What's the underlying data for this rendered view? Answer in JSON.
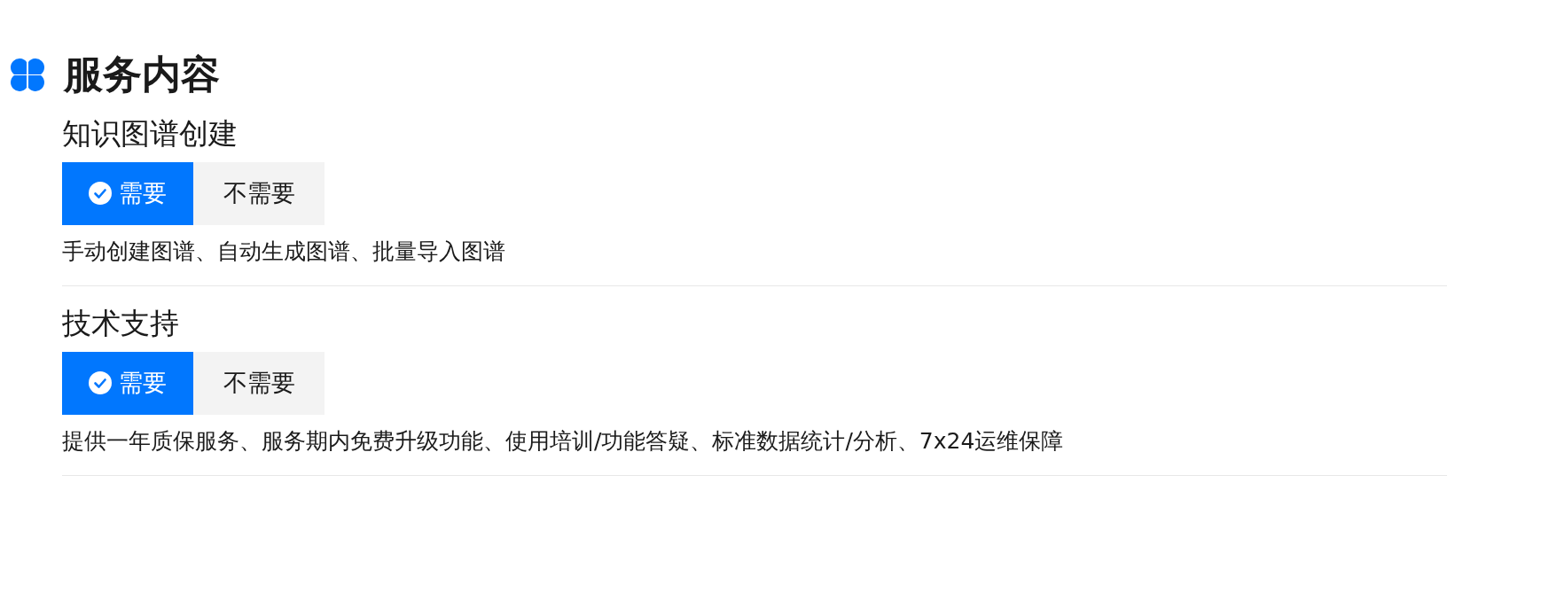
{
  "title": "服务内容",
  "sections": [
    {
      "name": "知识图谱创建",
      "options": [
        {
          "label": "需要",
          "selected": true
        },
        {
          "label": "不需要",
          "selected": false
        }
      ],
      "description": "手动创建图谱、自动生成图谱、批量导入图谱"
    },
    {
      "name": "技术支持",
      "options": [
        {
          "label": "需要",
          "selected": true
        },
        {
          "label": "不需要",
          "selected": false
        }
      ],
      "description": "提供一年质保服务、服务期内免费升级功能、使用培训/功能答疑、标准数据统计/分析、7x24运维保障"
    }
  ]
}
